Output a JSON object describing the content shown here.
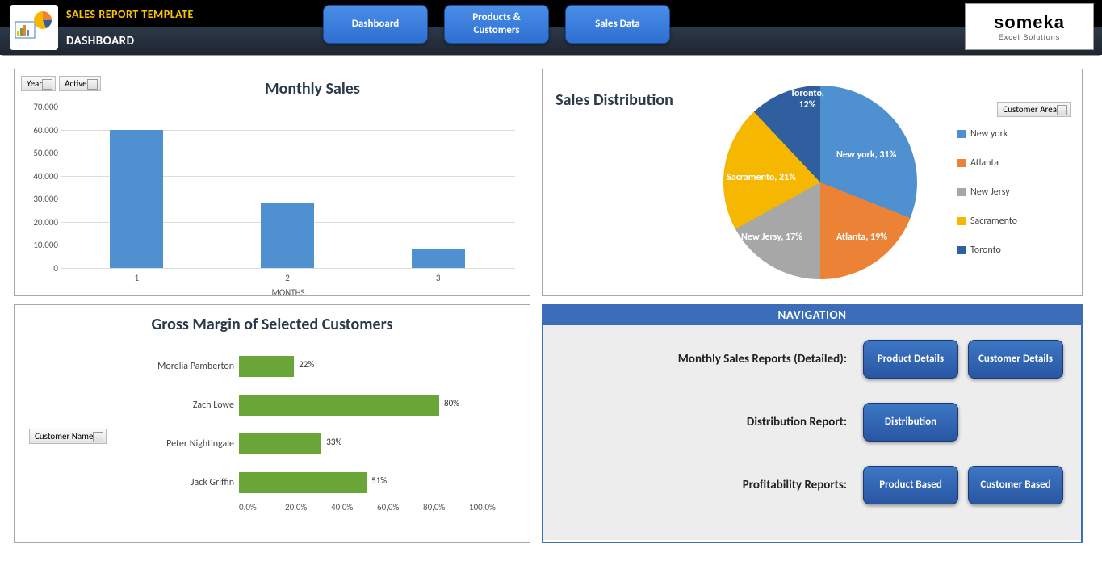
{
  "header": {
    "title": "SALES REPORT TEMPLATE",
    "subtitle": "DASHBOARD",
    "nav": [
      "Dashboard",
      "Products & Customers",
      "Sales Data"
    ],
    "logo_main": "someka",
    "logo_sub": "Excel Solutions"
  },
  "monthly": {
    "title": "Monthly Sales",
    "slicers": [
      "Year",
      "Active"
    ],
    "xlabel": "MONTHS",
    "yticks": [
      "0",
      "10.000",
      "20.000",
      "30.000",
      "40.000",
      "50.000",
      "60.000",
      "70.000"
    ]
  },
  "margins": {
    "title": "Gross Margin of Selected Customers",
    "slicer": "Customer Name",
    "xticks": [
      "0,0%",
      "20,0%",
      "40,0%",
      "60,0%",
      "80,0%",
      "100,0%"
    ]
  },
  "distribution": {
    "title": "Sales Distribution",
    "slicer": "Customer Area"
  },
  "navigation": {
    "title": "NAVIGATION",
    "rows": [
      {
        "label": "Monthly Sales Reports (Detailed):",
        "buttons": [
          "Product Details",
          "Customer Details"
        ]
      },
      {
        "label": "Distribution Report:",
        "buttons": [
          "Distribution"
        ]
      },
      {
        "label": "Profitability Reports:",
        "buttons": [
          "Product Based",
          "Customer Based"
        ]
      }
    ]
  },
  "chart_data": [
    {
      "type": "bar",
      "title": "Monthly Sales",
      "xlabel": "MONTHS",
      "categories": [
        "1",
        "2",
        "3"
      ],
      "values": [
        60000,
        28000,
        8000
      ],
      "ylim": [
        0,
        70000
      ]
    },
    {
      "type": "bar",
      "orientation": "horizontal",
      "title": "Gross Margin of Selected Customers",
      "categories": [
        "Morelia Pamberton",
        "Zach Lowe",
        "Peter Nightingale",
        "Jack Griffin"
      ],
      "values": [
        22,
        80,
        33,
        51
      ],
      "xlim": [
        0,
        100
      ],
      "unit": "%"
    },
    {
      "type": "pie",
      "title": "Sales Distribution",
      "series": [
        {
          "name": "New york",
          "value": 31,
          "color": "#4f90d1"
        },
        {
          "name": "Atlanta",
          "value": 19,
          "color": "#ec8235"
        },
        {
          "name": "New Jersy",
          "value": 17,
          "color": "#a7a7a7"
        },
        {
          "name": "Sacramento",
          "value": 21,
          "color": "#f5b700"
        },
        {
          "name": "Toronto",
          "value": 12,
          "color": "#2f5f9e"
        }
      ]
    }
  ]
}
